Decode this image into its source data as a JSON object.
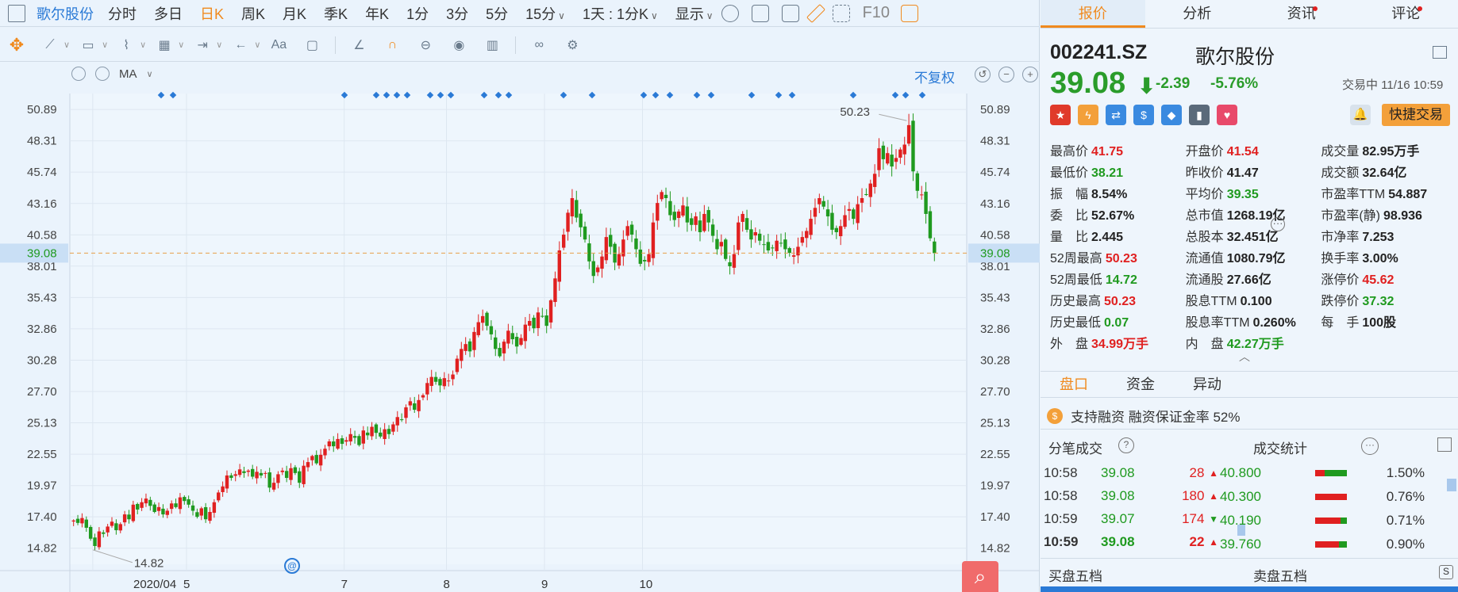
{
  "topbar": {
    "stock_name": "歌尔股份",
    "periods": [
      "分时",
      "多日",
      "日K",
      "周K",
      "月K",
      "季K",
      "年K",
      "1分",
      "3分",
      "5分",
      "15分"
    ],
    "active_period": "日K",
    "range_label": "1天 : 1分K",
    "display_label": "显示",
    "f10": "F10"
  },
  "toolbar": {
    "text_tool": "Aa"
  },
  "chart_header": {
    "indicator": "MA",
    "adjust": "不复权"
  },
  "chart_data": {
    "type": "candlestick",
    "x_ticks": [
      "2020/04",
      "5",
      "7",
      "8",
      "9",
      "10"
    ],
    "y_ticks": [
      14.82,
      17.4,
      19.97,
      22.55,
      25.13,
      27.7,
      30.28,
      32.86,
      35.43,
      38.01,
      40.58,
      43.16,
      45.74,
      48.31,
      50.89
    ],
    "ylim": [
      13.5,
      52.2
    ],
    "current_price": 39.08,
    "max_label": 50.23,
    "min_label": 14.82,
    "colors": {
      "up": "#e02020",
      "down": "#1f9a1f",
      "current_line": "#e8a04a"
    },
    "closes": [
      17.1,
      16.9,
      17.3,
      16.5,
      15.6,
      15.0,
      16.2,
      16.0,
      16.6,
      17.0,
      16.3,
      16.8,
      17.6,
      17.2,
      18.4,
      18.0,
      18.6,
      18.9,
      18.3,
      17.8,
      18.2,
      17.6,
      17.9,
      18.5,
      18.2,
      19.0,
      18.7,
      18.4,
      17.9,
      17.4,
      18.1,
      17.2,
      17.8,
      18.6,
      19.4,
      19.9,
      20.8,
      20.6,
      20.9,
      21.3,
      21.0,
      21.2,
      20.7,
      21.1,
      20.8,
      21.0,
      19.8,
      20.2,
      20.9,
      21.2,
      20.6,
      21.4,
      21.0,
      20.2,
      21.6,
      21.9,
      22.4,
      21.8,
      22.5,
      23.0,
      23.6,
      23.2,
      23.8,
      23.4,
      23.7,
      24.2,
      23.9,
      23.3,
      24.5,
      24.1,
      24.8,
      24.3,
      24.0,
      24.6,
      24.2,
      25.0,
      25.6,
      25.4,
      26.4,
      26.9,
      26.2,
      27.0,
      27.4,
      28.4,
      28.9,
      28.5,
      28.2,
      28.8,
      28.6,
      29.1,
      30.4,
      31.2,
      31.6,
      31.0,
      32.6,
      33.4,
      33.9,
      33.1,
      32.4,
      31.2,
      30.6,
      31.8,
      32.7,
      32.0,
      31.4,
      32.1,
      33.2,
      33.5,
      32.9,
      34.2,
      33.9,
      33.1,
      35.2,
      37.0,
      39.3,
      40.6,
      42.4,
      43.6,
      42.0,
      41.2,
      40.2,
      38.4,
      37.2,
      37.9,
      38.8,
      40.4,
      39.6,
      38.3,
      39.0,
      40.2,
      41.3,
      40.6,
      39.4,
      38.2,
      38.4,
      39.0,
      41.6,
      43.2,
      44.1,
      43.6,
      42.2,
      41.8,
      42.5,
      43.0,
      41.6,
      41.4,
      42.1,
      40.8,
      42.3,
      41.6,
      40.5,
      39.4,
      40.0,
      38.6,
      38.0,
      39.0,
      41.6,
      42.3,
      41.0,
      40.2,
      40.8,
      40.1,
      39.8,
      39.3,
      39.5,
      40.1,
      39.9,
      39.4,
      39.1,
      38.9,
      39.6,
      40.4,
      40.9,
      41.9,
      42.8,
      43.6,
      42.9,
      42.1,
      41.0,
      40.8,
      41.3,
      42.2,
      42.7,
      41.9,
      43.1,
      43.6,
      43.9,
      44.8,
      45.6,
      47.7,
      46.8,
      47.3,
      46.2,
      46.9,
      47.6,
      48.0,
      49.6,
      45.8,
      44.2,
      43.9,
      42.3,
      40.3,
      39.08
    ]
  },
  "side": {
    "tabs": [
      "报价",
      "分析",
      "资讯",
      "评论"
    ],
    "active_tab": "报价",
    "code": "002241.SZ",
    "name": "歌尔股份",
    "price": "39.08",
    "change": "-2.39",
    "change_pct": "-5.76%",
    "trade_status": "交易中 11/16 10:59",
    "quick_trade": "快捷交易",
    "stats": [
      [
        {
          "k": "最高价",
          "v": "41.75",
          "c": "red"
        },
        {
          "k": "开盘价",
          "v": "41.54",
          "c": "red"
        },
        {
          "k": "成交量",
          "v": "82.95万手",
          "c": "dark"
        }
      ],
      [
        {
          "k": "最低价",
          "v": "38.21",
          "c": "green"
        },
        {
          "k": "昨收价",
          "v": "41.47",
          "c": "dark"
        },
        {
          "k": "成交额",
          "v": "32.64亿",
          "c": "dark"
        }
      ],
      [
        {
          "k": "振　幅",
          "v": "8.54%",
          "c": "dark"
        },
        {
          "k": "平均价",
          "v": "39.35",
          "c": "green"
        },
        {
          "k": "市盈率TTM",
          "v": "54.887",
          "c": "dark"
        }
      ],
      [
        {
          "k": "委　比",
          "v": "52.67%",
          "c": "dark"
        },
        {
          "k": "总市值",
          "v": "1268.19亿",
          "c": "dark"
        },
        {
          "k": "市盈率(静)",
          "v": "98.936",
          "c": "dark"
        }
      ],
      [
        {
          "k": "量　比",
          "v": "2.445",
          "c": "dark"
        },
        {
          "k": "总股本",
          "v": "32.451亿",
          "c": "dark"
        },
        {
          "k": "市净率",
          "v": "7.253",
          "c": "dark"
        }
      ],
      [
        {
          "k": "52周最高",
          "v": "50.23",
          "c": "red"
        },
        {
          "k": "流通值",
          "v": "1080.79亿",
          "c": "dark"
        },
        {
          "k": "换手率",
          "v": "3.00%",
          "c": "dark"
        }
      ],
      [
        {
          "k": "52周最低",
          "v": "14.72",
          "c": "green"
        },
        {
          "k": "流通股",
          "v": "27.66亿",
          "c": "dark"
        },
        {
          "k": "涨停价",
          "v": "45.62",
          "c": "red"
        }
      ],
      [
        {
          "k": "历史最高",
          "v": "50.23",
          "c": "red"
        },
        {
          "k": "股息TTM",
          "v": "0.100",
          "c": "dark"
        },
        {
          "k": "跌停价",
          "v": "37.32",
          "c": "green"
        }
      ],
      [
        {
          "k": "历史最低",
          "v": "0.07",
          "c": "green"
        },
        {
          "k": "股息率TTM",
          "v": "0.260%",
          "c": "dark"
        },
        {
          "k": "每　手",
          "v": "100股",
          "c": "dark"
        }
      ],
      [
        {
          "k": "外　盘",
          "v": "34.99万手",
          "c": "red"
        },
        {
          "k": "内　盘",
          "v": "42.27万手",
          "c": "green"
        },
        {
          "k": "",
          "v": "",
          "c": "dark"
        }
      ]
    ],
    "panel_tabs": [
      "盘口",
      "资金",
      "异动"
    ],
    "active_panel": "盘口",
    "margin_text": "支持融资  融资保证金率 52%",
    "ticks_title": "分笔成交",
    "dist_title": "成交统计",
    "ticks": [
      {
        "t": "10:58",
        "p": "39.08",
        "v": "28",
        "d": "up"
      },
      {
        "t": "10:58",
        "p": "39.08",
        "v": "180",
        "d": "up"
      },
      {
        "t": "10:59",
        "p": "39.07",
        "v": "174",
        "d": "down"
      },
      {
        "t": "10:59",
        "p": "39.08",
        "v": "22",
        "d": "up"
      }
    ],
    "dist": [
      {
        "p": "40.800",
        "pct": "1.50%",
        "green": 0.7
      },
      {
        "p": "40.300",
        "pct": "0.76%",
        "green": 0.0
      },
      {
        "p": "40.190",
        "pct": "0.71%",
        "green": 0.2
      },
      {
        "p": "39.760",
        "pct": "0.90%",
        "green": 0.25
      }
    ],
    "buy5": "买盘五档",
    "sell5": "卖盘五档"
  }
}
